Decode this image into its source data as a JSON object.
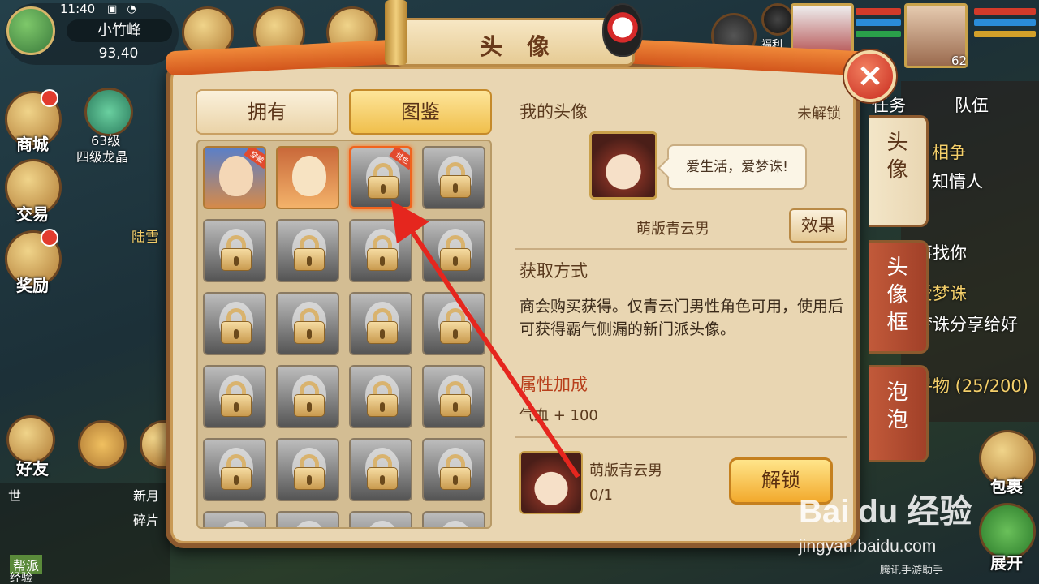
{
  "hud": {
    "time": "11:40",
    "location_name": "小竹峰",
    "coords": "93,40",
    "left_buttons": [
      {
        "label": "商城"
      },
      {
        "label": "交易"
      },
      {
        "label": "奖励"
      }
    ],
    "dragon_level": "63级",
    "dragon_label": "四级龙晶",
    "friends_label": "好友",
    "npc_name": "陆雪",
    "chat_line1": "世",
    "chat_line2": "新月",
    "chat_line3": "碎片",
    "chat_tag": "帮派",
    "exp_label": "经验",
    "welfare_label": "福利",
    "portrait_level": "62",
    "right_texts": [
      "任务",
      "队伍",
      "相争",
      "知情人",
      "事找你",
      "爱梦诛",
      "梦诛分享给好",
      "寻物 (25/200)"
    ],
    "bag_label": "包裹",
    "expand_label": "展开"
  },
  "dialog": {
    "title": "头像",
    "close_icon": "×",
    "tabs": {
      "own": "拥有",
      "catalog": "图鉴"
    },
    "my_avatar_label": "我的头像",
    "status": "未解锁",
    "bubble_text": "爱生活，爱梦诛!",
    "avatar_name": "萌版青云男",
    "effect_button": "效果",
    "obtain_title": "获取方式",
    "obtain_desc": "商会购买获得。仅青云门男性角色可用，使用后可获得霸气侧漏的新门派头像。",
    "attr_title": "属性加成",
    "attr_value": "气血 + 100",
    "item_name": "萌版青云男",
    "item_count": "0/1",
    "unlock_button": "解锁",
    "side_tabs": [
      "头像",
      "头像框",
      "泡泡"
    ],
    "grid_tags": [
      "穿戴",
      "试色"
    ]
  },
  "watermark": {
    "brand": "Bai du 经验",
    "url": "jingyan.baidu.com",
    "sub": "腾讯手游助手"
  },
  "colors": {
    "dialog_bg": "#e9d6b2",
    "border": "#8d5a2e",
    "accent_orange": "#f0641e",
    "unlock_gold": "#f2a92c",
    "arrow_red": "#e5261e"
  }
}
